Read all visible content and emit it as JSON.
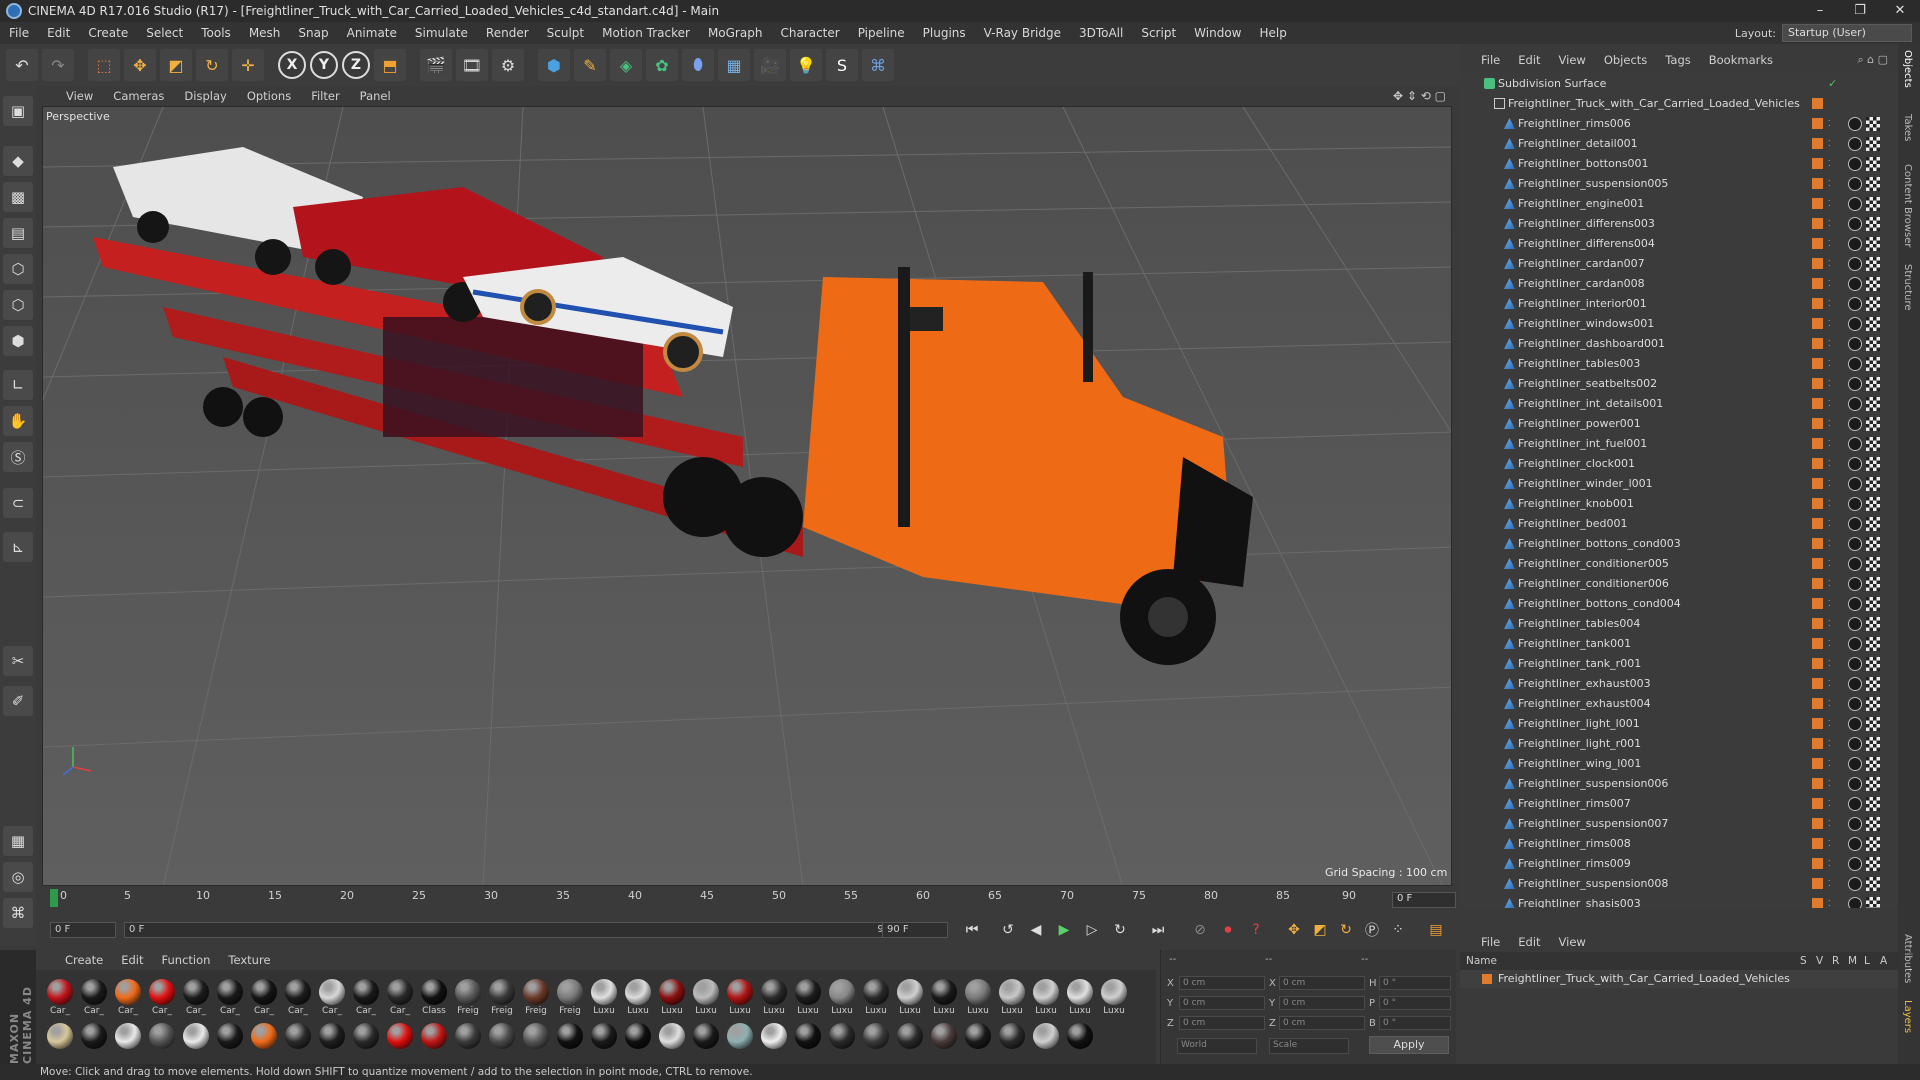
{
  "window": {
    "title": "CINEMA 4D R17.016 Studio (R17) - [Freightliner_Truck_with_Car_Carried_Loaded_Vehicles_c4d_standart.c4d] - Main",
    "buttons": [
      "–",
      "❐",
      "✕"
    ]
  },
  "menu": [
    "File",
    "Edit",
    "Create",
    "Select",
    "Tools",
    "Mesh",
    "Snap",
    "Animate",
    "Simulate",
    "Render",
    "Sculpt",
    "Motion Tracker",
    "MoGraph",
    "Character",
    "Pipeline",
    "Plugins",
    "V-Ray Bridge",
    "3DToAll",
    "Script",
    "Window",
    "Help"
  ],
  "layout": {
    "label": "Layout:",
    "value": "Startup (User)"
  },
  "toolbar": {
    "axis_x": "X",
    "axis_y": "Y",
    "axis_z": "Z"
  },
  "viewport": {
    "menu": [
      "View",
      "Cameras",
      "Display",
      "Options",
      "Filter",
      "Panel"
    ],
    "label": "Perspective",
    "grid_spacing": "Grid Spacing : 100 cm"
  },
  "timeline": {
    "ticks": [
      "0",
      "5",
      "10",
      "15",
      "20",
      "25",
      "30",
      "35",
      "40",
      "45",
      "50",
      "55",
      "60",
      "65",
      "70",
      "75",
      "80",
      "85",
      "90"
    ],
    "end_field": "0 F"
  },
  "transport": {
    "start_field": "0 F",
    "slider_left": "0 F",
    "slider_right": "90 F",
    "end_field": "90 F"
  },
  "materials": {
    "menu": [
      "Create",
      "Edit",
      "Function",
      "Texture"
    ],
    "row1": [
      {
        "label": "Car_",
        "color": "#c0141a"
      },
      {
        "label": "Car_",
        "color": "#1a1a1a"
      },
      {
        "label": "Car_",
        "color": "#f06a1a"
      },
      {
        "label": "Car_",
        "color": "#e01010"
      },
      {
        "label": "Car_",
        "color": "#1c1c1c"
      },
      {
        "label": "Car_",
        "color": "#1a1a1a"
      },
      {
        "label": "Car_",
        "color": "#151515"
      },
      {
        "label": "Car_",
        "color": "#1d1d1d"
      },
      {
        "label": "Car_",
        "color": "#d8d8d8"
      },
      {
        "label": "Car_",
        "color": "#1a1a1a"
      },
      {
        "label": "Car_",
        "color": "#2a2a2a"
      },
      {
        "label": "Class",
        "color": "#111"
      },
      {
        "label": "Freig",
        "color": "#5a5a5a"
      },
      {
        "label": "Freig",
        "color": "#3a3a3a"
      },
      {
        "label": "Freig",
        "color": "#6a3a2a"
      },
      {
        "label": "Freig",
        "color": "#7a7a7a"
      },
      {
        "label": "Luxu",
        "color": "#e0e0e0"
      },
      {
        "label": "Luxu",
        "color": "#dcdcdc"
      },
      {
        "label": "Luxu",
        "color": "#8a1010"
      },
      {
        "label": "Luxu",
        "color": "#bcbcbc"
      },
      {
        "label": "Luxu",
        "color": "#b01414"
      },
      {
        "label": "Luxu",
        "color": "#2a2a2a"
      },
      {
        "label": "Luxu",
        "color": "#1e1e1e"
      },
      {
        "label": "Luxu",
        "color": "#888"
      },
      {
        "label": "Luxu",
        "color": "#2a2a2a"
      },
      {
        "label": "Luxu",
        "color": "#cfcfcf"
      },
      {
        "label": "Luxu",
        "color": "#1a1a1a"
      },
      {
        "label": "Luxu",
        "color": "#7a7a7a"
      },
      {
        "label": "Luxu",
        "color": "#c8c8c8"
      },
      {
        "label": "Luxu",
        "color": "#d0d0d0"
      },
      {
        "label": "Luxu",
        "color": "#e0e0e0"
      },
      {
        "label": "Luxu",
        "color": "#cfcfcf"
      }
    ],
    "row2": [
      {
        "label": "",
        "color": "#d8c89a"
      },
      {
        "label": "",
        "color": "#1a1a1a"
      },
      {
        "label": "",
        "color": "#e8e8e8"
      },
      {
        "label": "",
        "color": "#555"
      },
      {
        "label": "",
        "color": "#eaeaea"
      },
      {
        "label": "",
        "color": "#1a1a1a"
      },
      {
        "label": "",
        "color": "#f06a1a"
      },
      {
        "label": "",
        "color": "#2a2a2a"
      },
      {
        "label": "",
        "color": "#1e1e1e"
      },
      {
        "label": "",
        "color": "#2a2a2a"
      },
      {
        "label": "",
        "color": "#e01010"
      },
      {
        "label": "",
        "color": "#c01515"
      },
      {
        "label": "",
        "color": "#3a3a3a"
      },
      {
        "label": "",
        "color": "#4a4a4a"
      },
      {
        "label": "",
        "color": "#555"
      },
      {
        "label": "",
        "color": "#111"
      },
      {
        "label": "",
        "color": "#1a1a1a"
      },
      {
        "label": "",
        "color": "#0f0f0f"
      },
      {
        "label": "",
        "color": "#e0e0e0"
      },
      {
        "label": "",
        "color": "#1a1a1a"
      },
      {
        "label": "",
        "color": "#8fb0b0"
      },
      {
        "label": "",
        "color": "#f0f0f0"
      },
      {
        "label": "",
        "color": "#111"
      },
      {
        "label": "",
        "color": "#2a2a2a"
      },
      {
        "label": "",
        "color": "#3a3a3a"
      },
      {
        "label": "",
        "color": "#2a2a2a"
      },
      {
        "label": "",
        "color": "#4a3a3a"
      },
      {
        "label": "",
        "color": "#1a1a1a"
      },
      {
        "label": "",
        "color": "#2a2a2a"
      },
      {
        "label": "",
        "color": "#cfcfcf"
      },
      {
        "label": "",
        "color": "#111"
      }
    ]
  },
  "coords": {
    "header": [
      "--",
      "--",
      "--"
    ],
    "rows": [
      {
        "a": "X",
        "av": "0 cm",
        "b": "X",
        "bv": "0 cm",
        "c": "H",
        "cv": "0 °"
      },
      {
        "a": "Y",
        "av": "0 cm",
        "b": "Y",
        "bv": "0 cm",
        "c": "P",
        "cv": "0 °"
      },
      {
        "a": "Z",
        "av": "0 cm",
        "b": "Z",
        "bv": "0 cm",
        "c": "B",
        "cv": "0 °"
      }
    ],
    "world": "World",
    "scale": "Scale",
    "apply": "Apply"
  },
  "status": "Move: Click and drag to move elements. Hold down SHIFT to quantize movement / add to the selection in point mode, CTRL to remove.",
  "object_manager": {
    "menu": [
      "File",
      "Edit",
      "View",
      "Objects",
      "Tags",
      "Bookmarks"
    ],
    "root": "Subdivision Surface",
    "group": "Freightliner_Truck_with_Car_Carried_Loaded_Vehicles",
    "items": [
      "Freightliner_rims006",
      "Freightliner_detail001",
      "Freightliner_bottons001",
      "Freightliner_suspension005",
      "Freightliner_engine001",
      "Freightliner_differens003",
      "Freightliner_differens004",
      "Freightliner_cardan007",
      "Freightliner_cardan008",
      "Freightliner_interior001",
      "Freightliner_windows001",
      "Freightliner_dashboard001",
      "Freightliner_tables003",
      "Freightliner_seatbelts002",
      "Freightliner_int_details001",
      "Freightliner_power001",
      "Freightliner_int_fuel001",
      "Freightliner_clock001",
      "Freightliner_winder_l001",
      "Freightliner_knob001",
      "Freightliner_bed001",
      "Freightliner_bottons_cond003",
      "Freightliner_conditioner005",
      "Freightliner_conditioner006",
      "Freightliner_bottons_cond004",
      "Freightliner_tables004",
      "Freightliner_tank001",
      "Freightliner_tank_r001",
      "Freightliner_exhaust003",
      "Freightliner_exhaust004",
      "Freightliner_light_l001",
      "Freightliner_light_r001",
      "Freightliner_wing_l001",
      "Freightliner_suspension006",
      "Freightliner_rims007",
      "Freightliner_suspension007",
      "Freightliner_rims008",
      "Freightliner_rims009",
      "Freightliner_suspension008",
      "Freightliner_shasis003"
    ]
  },
  "layers": {
    "menu": [
      "File",
      "Edit",
      "View"
    ],
    "name_header": "Name",
    "flags": [
      "S",
      "V",
      "R",
      "M",
      "L",
      "A"
    ],
    "row": "Freightliner_Truck_with_Car_Carried_Loaded_Vehicles"
  },
  "right_tabs": [
    "Objects",
    "Takes",
    "Content Browser",
    "Structure"
  ],
  "right_tabs_bottom": [
    "Attributes",
    "Layers"
  ],
  "brand": "MAXON CINEMA 4D"
}
